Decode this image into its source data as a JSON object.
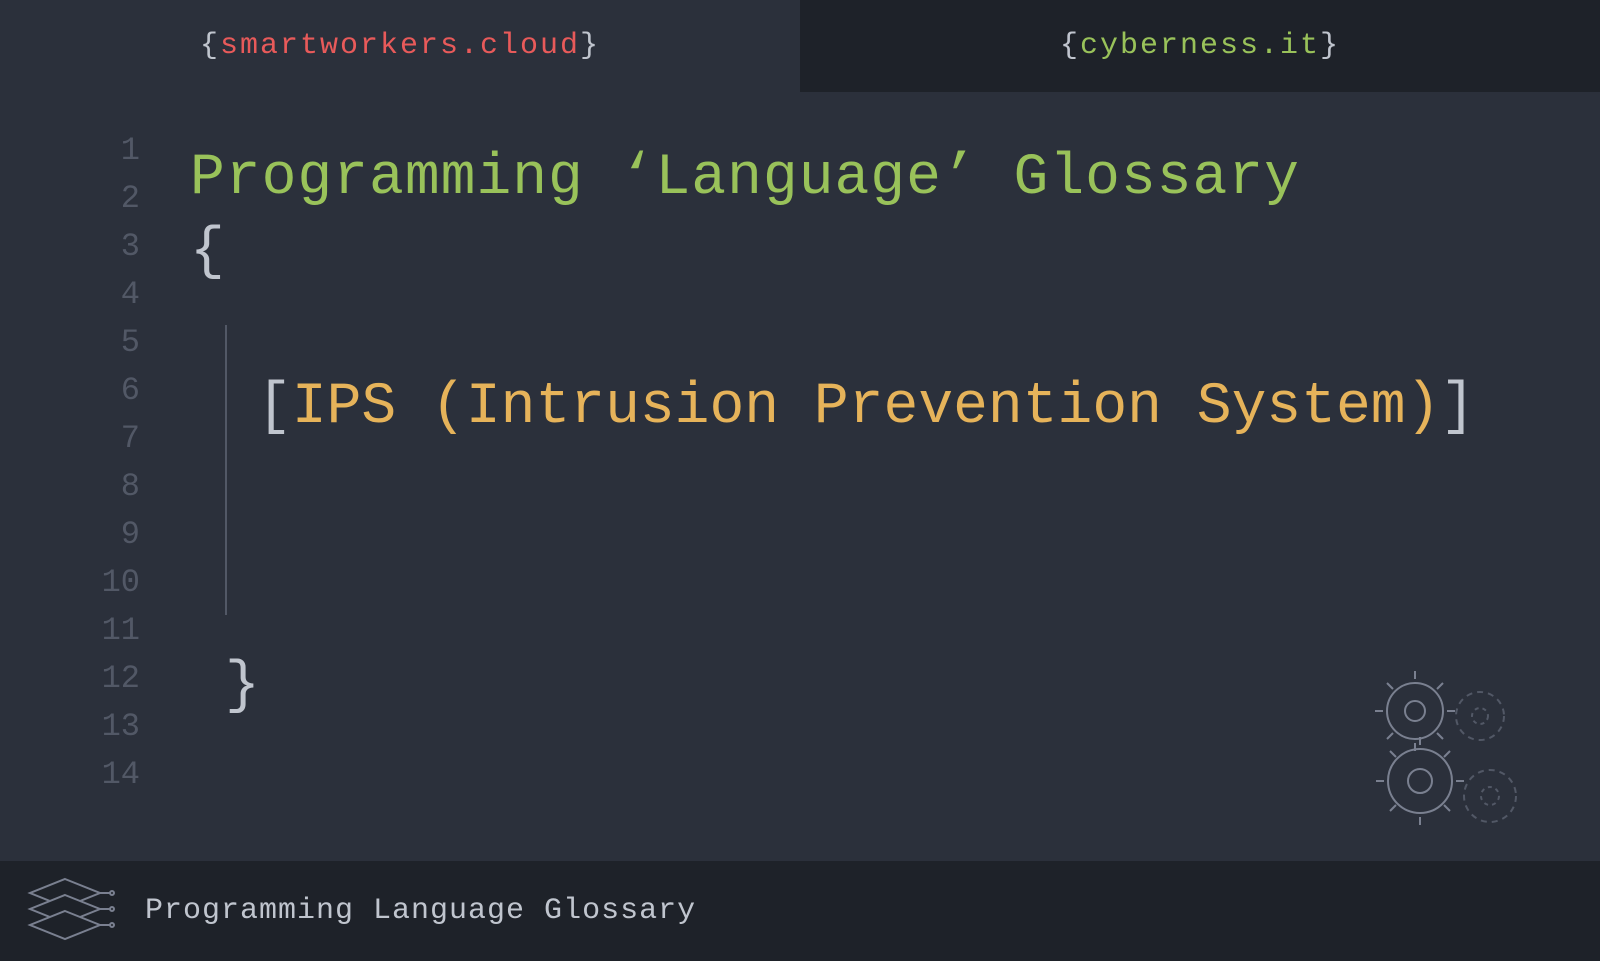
{
  "header": {
    "tab1": {
      "domain": "smartworkers.cloud"
    },
    "tab2": {
      "domain": "cyberness.it"
    }
  },
  "editor": {
    "lineNumbers": [
      "1",
      "2",
      "3",
      "4",
      "5",
      "6",
      "7",
      "8",
      "9",
      "10",
      "11",
      "12",
      "13",
      "14"
    ],
    "title": "Programming ‘Language’ Glossary",
    "openBrace": "{",
    "closeBrace": "}",
    "term": {
      "openBracket": "[",
      "text": "IPS (Intrusion Prevention System)",
      "closeBracket": "]"
    }
  },
  "footer": {
    "text": "Programming Language Glossary"
  }
}
